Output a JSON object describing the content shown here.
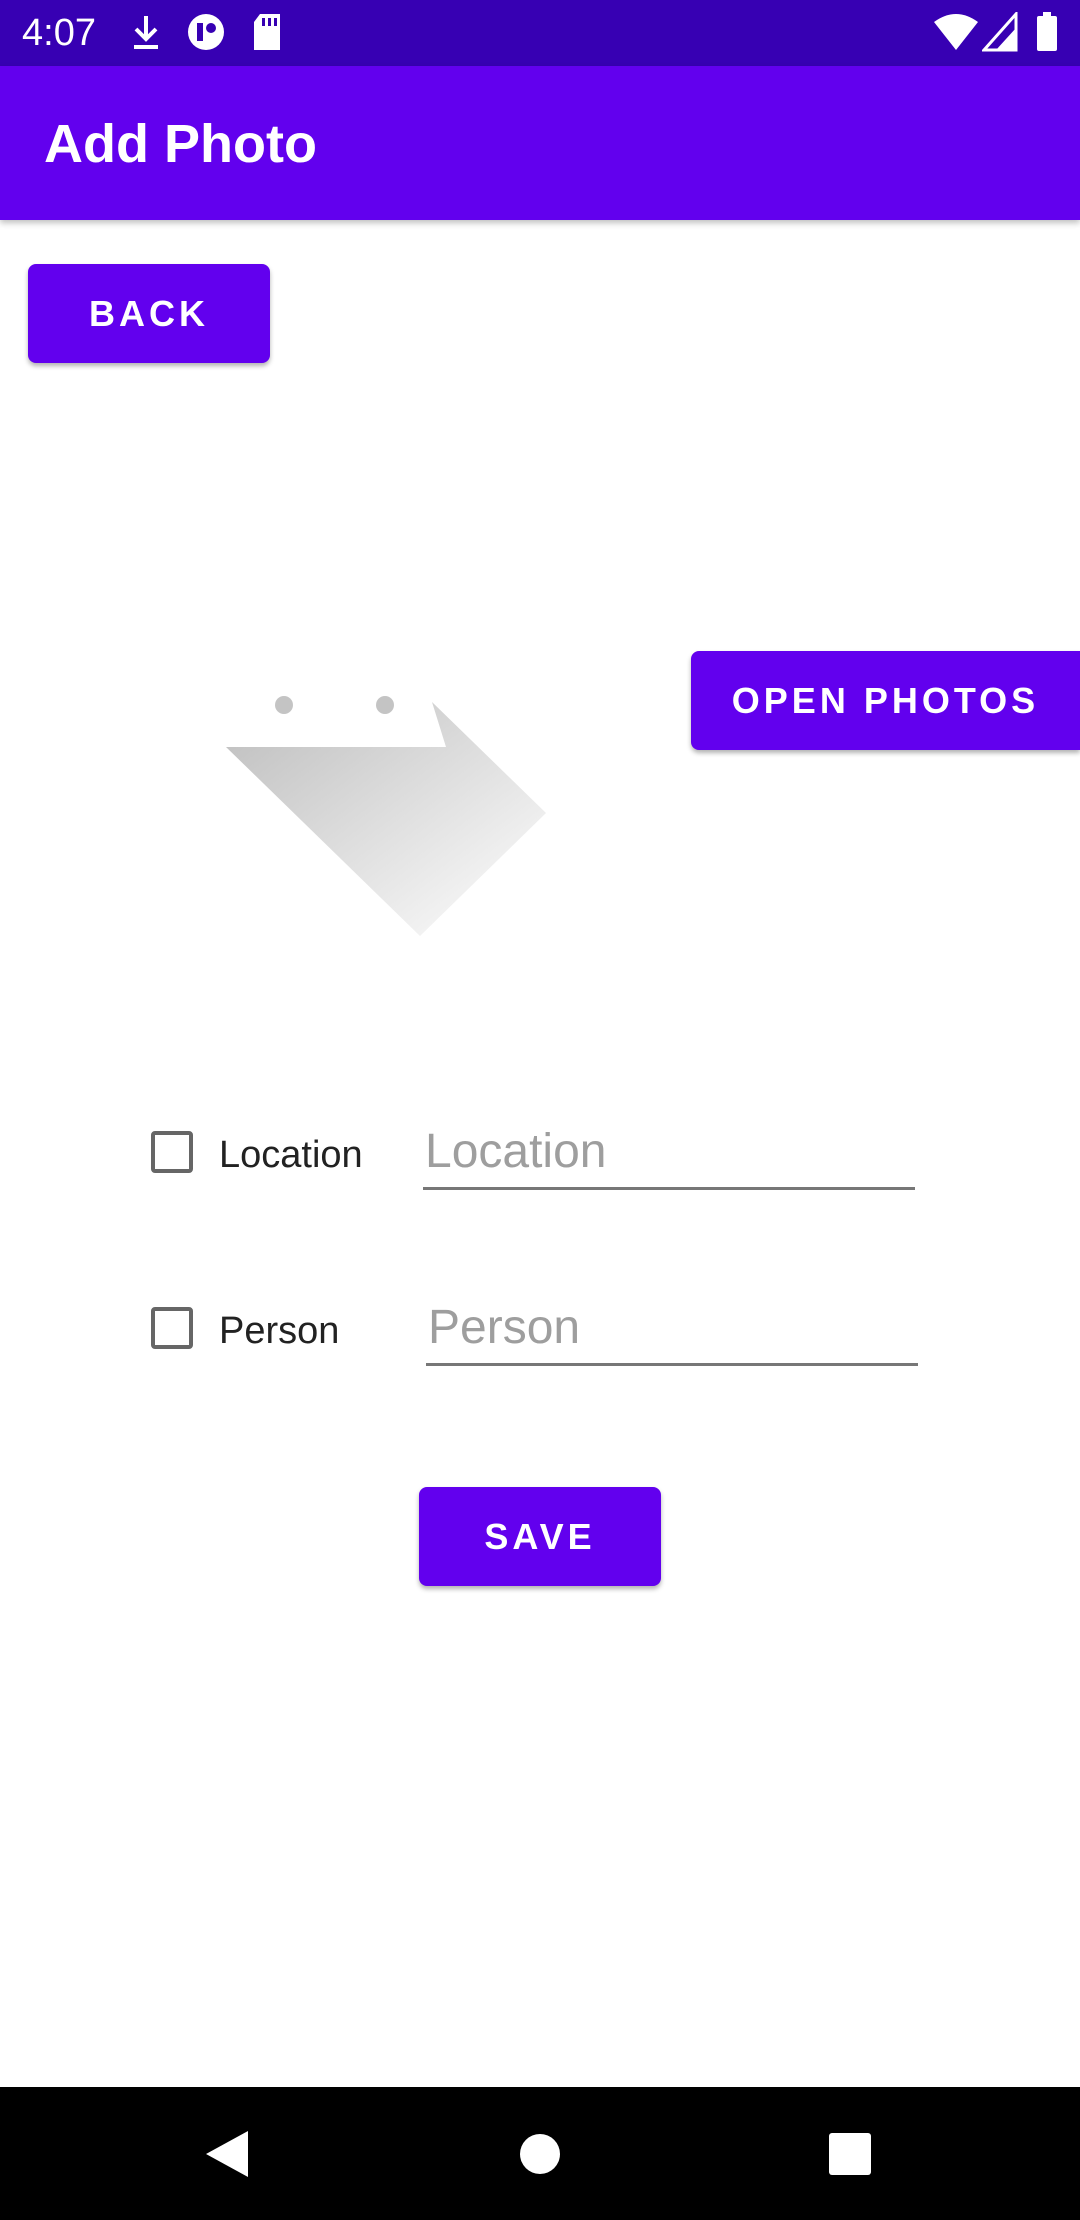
{
  "status_bar": {
    "time": "4:07",
    "icons": [
      "download-icon",
      "app-notification-icon",
      "sd-card-icon",
      "wifi-icon",
      "cell-signal-icon",
      "battery-icon"
    ]
  },
  "app_bar": {
    "title": "Add Photo"
  },
  "buttons": {
    "back": "BACK",
    "open_photos": "OPEN PHOTOS",
    "save": "SAVE"
  },
  "form": {
    "location": {
      "checkbox_label": "Location",
      "placeholder": "Location",
      "value": "",
      "checked": false
    },
    "person": {
      "checkbox_label": "Person",
      "placeholder": "Person",
      "value": "",
      "checked": false
    }
  },
  "nav_bar": {
    "icons": [
      "back-icon",
      "home-icon",
      "recents-icon"
    ]
  },
  "colors": {
    "status_bar": "#3700b3",
    "primary": "#6200ee",
    "nav_bar": "#000000"
  }
}
